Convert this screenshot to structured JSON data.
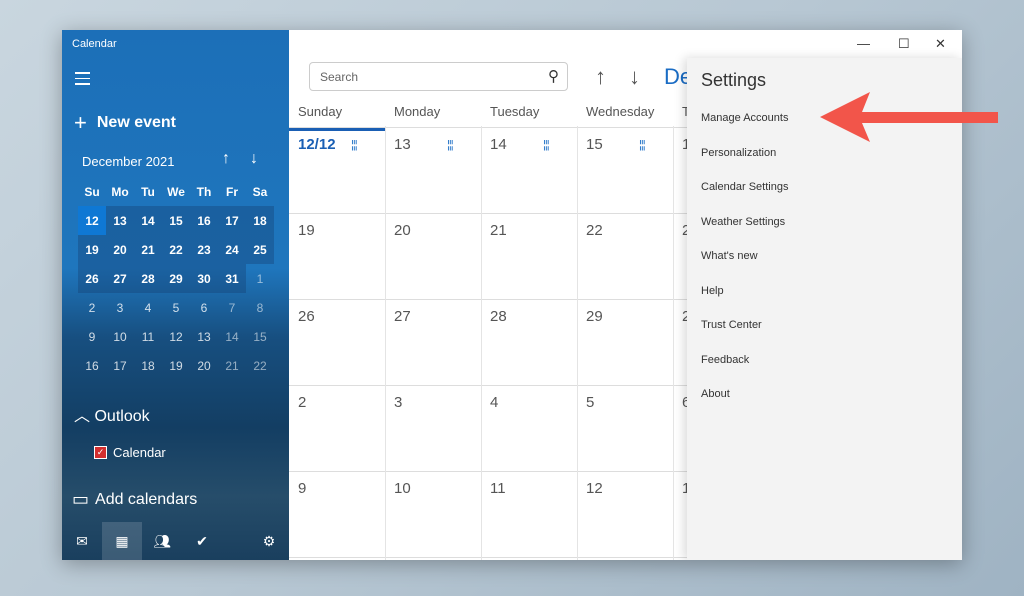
{
  "app_title": "Calendar",
  "sidebar": {
    "new_event": "New event",
    "month_label": "December 2021",
    "weekdays": [
      "Su",
      "Mo",
      "Tu",
      "We",
      "Th",
      "Fr",
      "Sa"
    ],
    "weeks": [
      [
        "12",
        "13",
        "14",
        "15",
        "16",
        "17",
        "18"
      ],
      [
        "19",
        "20",
        "21",
        "22",
        "23",
        "24",
        "25"
      ],
      [
        "26",
        "27",
        "28",
        "29",
        "30",
        "31",
        "1"
      ],
      [
        "2",
        "3",
        "4",
        "5",
        "6",
        "7",
        "8"
      ],
      [
        "9",
        "10",
        "11",
        "12",
        "13",
        "14",
        "15"
      ],
      [
        "16",
        "17",
        "18",
        "19",
        "20",
        "21",
        "22"
      ]
    ],
    "outlook": "Outlook",
    "calendar_item": "Calendar",
    "add_calendars": "Add calendars"
  },
  "search": {
    "placeholder": "Search"
  },
  "header_month": "De",
  "day_headers": [
    "Sunday",
    "Monday",
    "Tuesday",
    "Wednesday",
    "T"
  ],
  "rows": [
    [
      "12/12",
      "13",
      "14",
      "15",
      "1"
    ],
    [
      "19",
      "20",
      "21",
      "22",
      "2"
    ],
    [
      "26",
      "27",
      "28",
      "29",
      "2"
    ],
    [
      "2",
      "3",
      "4",
      "5",
      "6"
    ],
    [
      "9",
      "10",
      "11",
      "12",
      "1"
    ]
  ],
  "settings": {
    "title": "Settings",
    "items": [
      "Manage Accounts",
      "Personalization",
      "Calendar Settings",
      "Weather Settings",
      "What's new",
      "Help",
      "Trust Center",
      "Feedback",
      "About"
    ]
  },
  "colors": {
    "accent": "#1a5fb4",
    "arrow": "#f2554a"
  }
}
